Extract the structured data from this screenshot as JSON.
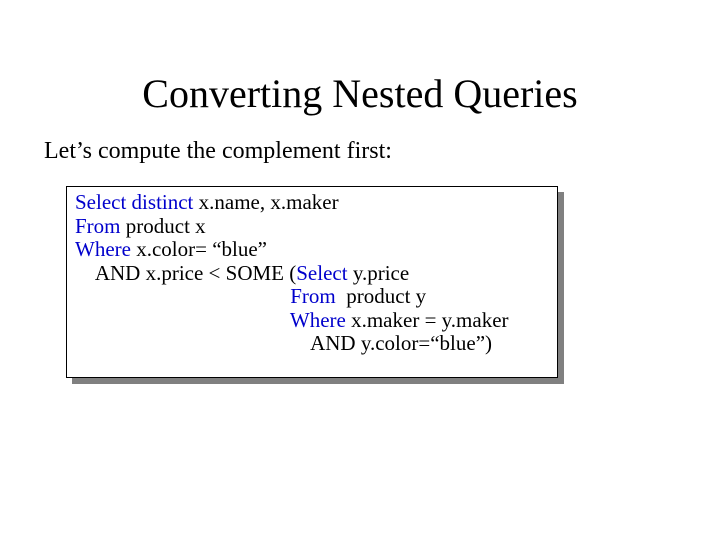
{
  "title": "Converting Nested Queries",
  "subtitle": "Let’s compute the complement first:",
  "sql": {
    "kw_select": "Select distinct ",
    "t_select_cols": "x.name, x.maker",
    "kw_from1": "From ",
    "t_from1": "product x",
    "kw_where1": "Where ",
    "t_where1": "x.color= “blue”",
    "t_and1_prefix": "    AND x.price < SOME (",
    "kw_select2": "Select ",
    "t_select2_cols": "y.price",
    "t_from2_prefix": "                                         ",
    "kw_from2": "From ",
    "t_from2": " product y",
    "t_where2_prefix": "                                         ",
    "kw_where2": "Where ",
    "t_where2": "x.maker = y.maker",
    "t_and2": "                                             AND y.color=“blue”)"
  }
}
